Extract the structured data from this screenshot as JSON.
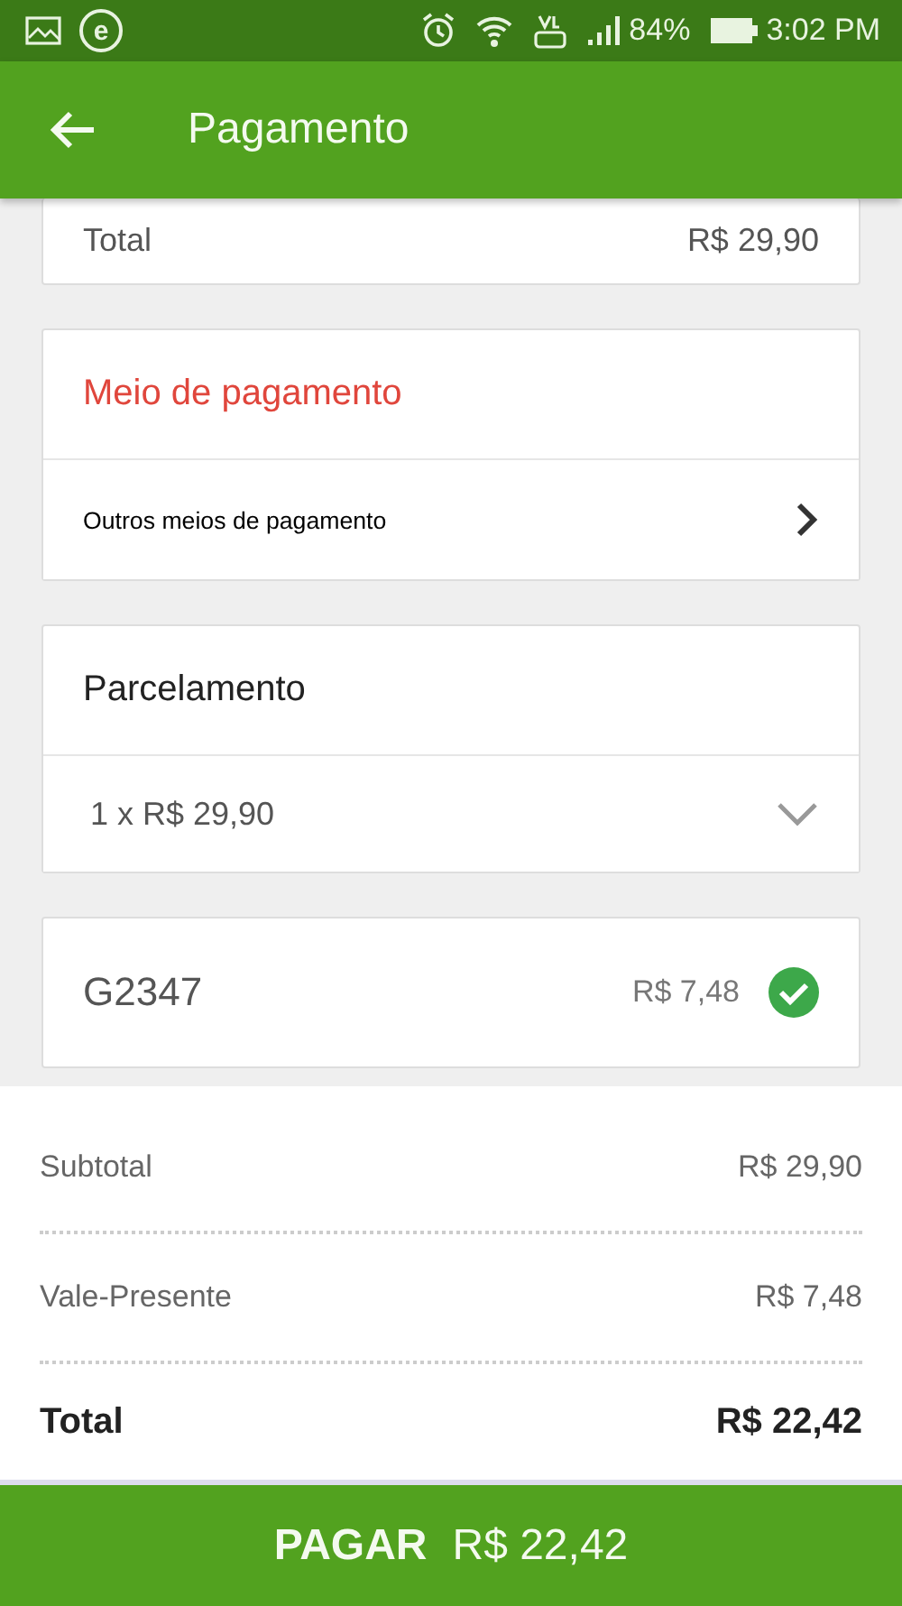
{
  "status_bar": {
    "app_badge": "e",
    "battery": "84%",
    "time": "3:02 PM"
  },
  "app_bar": {
    "title": "Pagamento"
  },
  "order_total": {
    "label": "Total",
    "value": "R$ 29,90"
  },
  "payment_method": {
    "title": "Meio de pagamento",
    "option": "Outros meios de pagamento"
  },
  "installments": {
    "title": "Parcelamento",
    "value": "1 x R$ 29,90"
  },
  "voucher": {
    "code": "G2347",
    "amount": "R$ 7,48",
    "applied": true
  },
  "summary": [
    {
      "label": "Subtotal",
      "value": "R$ 29,90",
      "kind": "line"
    },
    {
      "label": "Vale-Presente",
      "value": "R$ 7,48",
      "kind": "line"
    },
    {
      "label": "Total",
      "value": "R$ 22,42",
      "kind": "total"
    }
  ],
  "pay_button": {
    "label": "PAGAR",
    "amount": "R$ 22,42"
  }
}
